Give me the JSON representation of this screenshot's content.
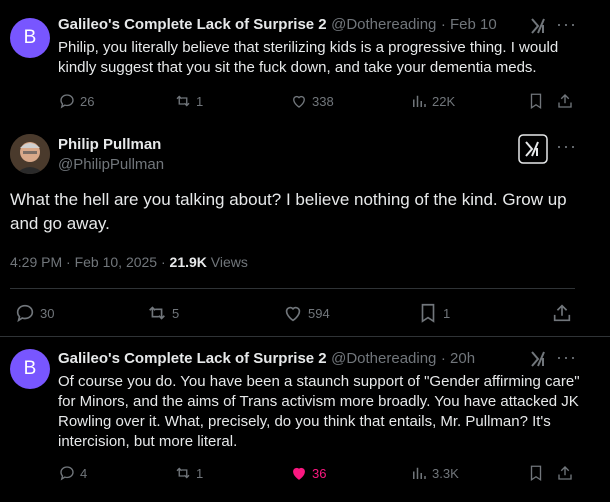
{
  "tweets": [
    {
      "avatar_letter": "B",
      "name": "Galileo's Complete Lack of Surprise 2",
      "handle": "@Dothereading",
      "time": "· Feb 10",
      "text": "Philip, you literally believe that sterilizing kids is a progressive thing. I would kindly suggest that you sit the fuck down, and take your dementia meds.",
      "replies": "26",
      "reposts": "1",
      "likes": "338",
      "views": "22K"
    },
    {
      "name": "Philip Pullman",
      "handle": "@PhilipPullman",
      "text": "What the hell are you talking about? I believe nothing of the kind. Grow up and go away.",
      "timestamp": "4:29 PM · Feb 10, 2025 ·",
      "views_count": "21.9K",
      "views_label": "Views",
      "replies": "30",
      "reposts": "5",
      "likes": "594",
      "bookmarks": "1"
    },
    {
      "avatar_letter": "B",
      "name": "Galileo's Complete Lack of Surprise 2",
      "handle": "@Dothereading",
      "time": "· 20h",
      "text": "Of course you do. You have been a staunch support of \"Gender affirming care\" for Minors, and the aims of Trans activism more broadly. You have attacked JK Rowling over it. What, precisely, do you think that entails, Mr. Pullman? It's intercision, but more literal.",
      "replies": "4",
      "reposts": "1",
      "likes": "36",
      "views": "3.3K"
    }
  ],
  "colors": {
    "background": "#000000",
    "text": "#e7e9ea",
    "muted": "#71767b",
    "like_active": "#f91880",
    "avatar": "#7856ff"
  },
  "icons": [
    "reply-icon",
    "repost-icon",
    "like-icon",
    "views-icon",
    "bookmark-icon",
    "share-icon",
    "grok-icon",
    "more-icon"
  ]
}
